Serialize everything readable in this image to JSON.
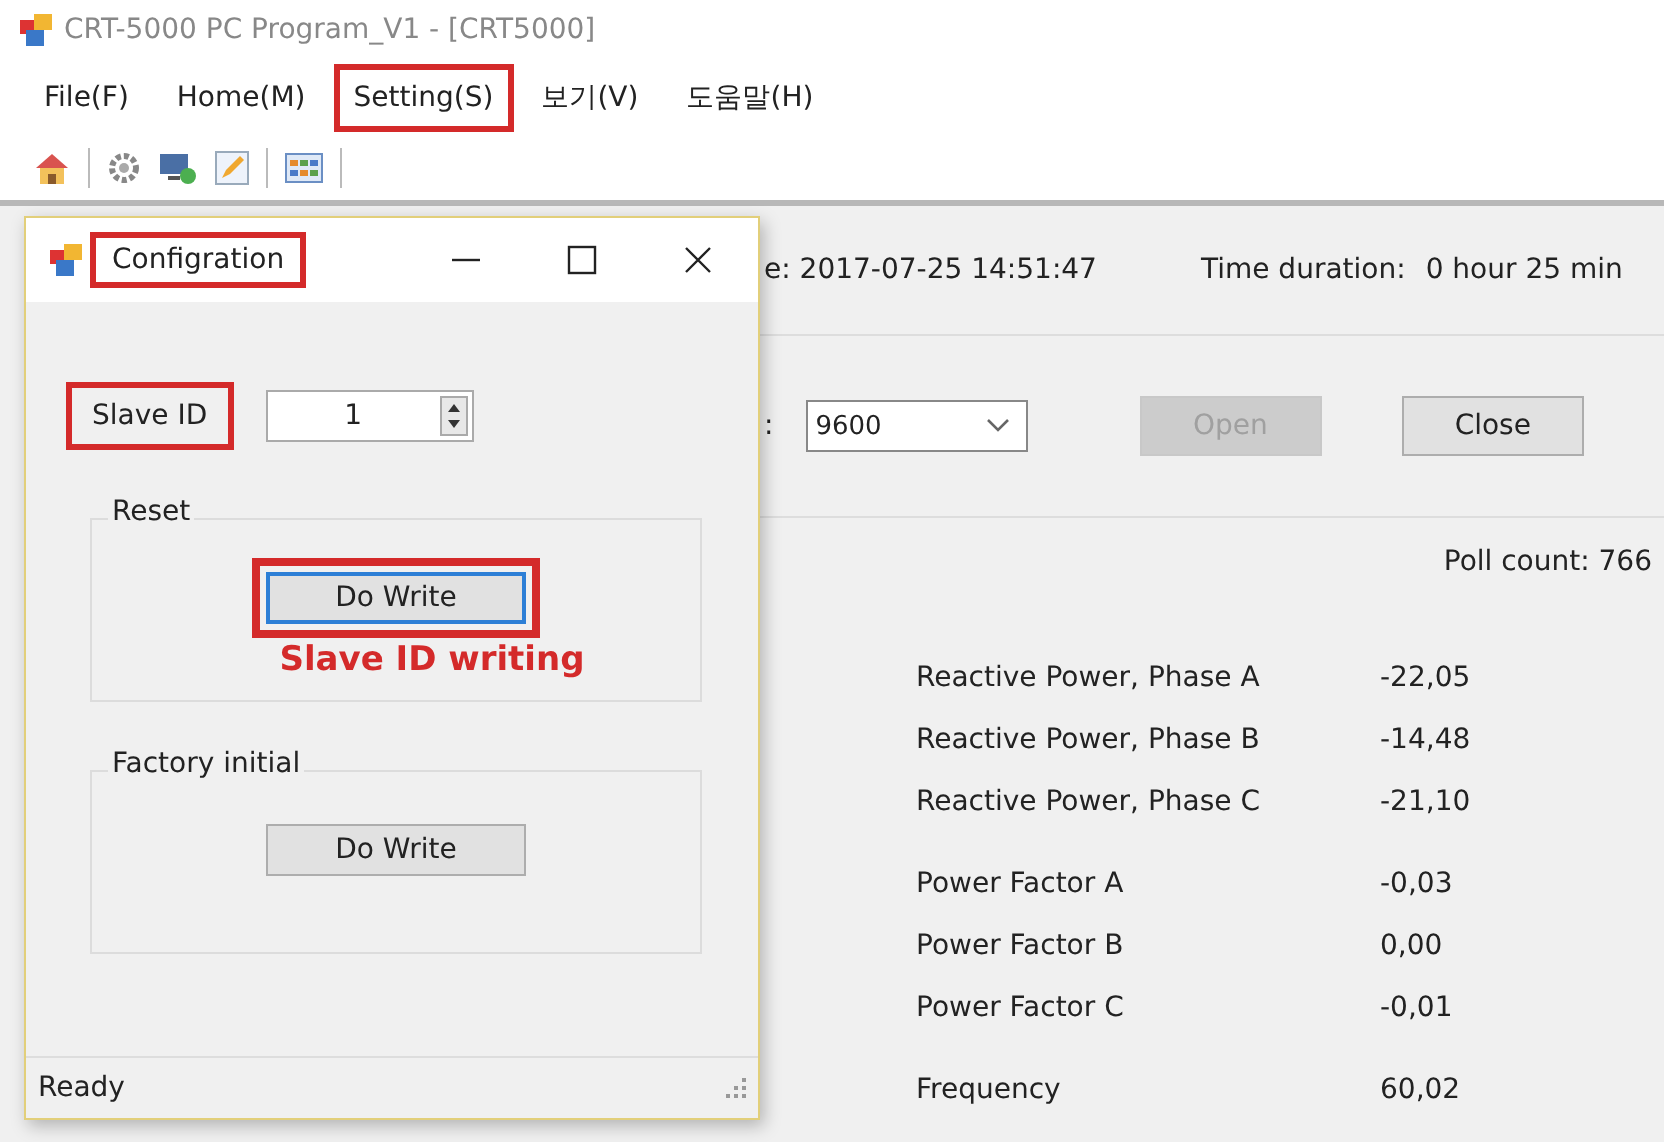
{
  "window": {
    "title": "CRT-5000 PC Program_V1 - [CRT5000]"
  },
  "menu": [
    {
      "label": "File(F)",
      "highlighted": false
    },
    {
      "label": "Home(M)",
      "highlighted": false
    },
    {
      "label": "Setting(S)",
      "highlighted": true
    },
    {
      "label": "보기(V)",
      "highlighted": false
    },
    {
      "label": "도움말(H)",
      "highlighted": false
    }
  ],
  "main": {
    "start_time": "e: 2017-07-25 14:51:47",
    "duration_label": "Time duration:",
    "duration_value": "0 hour 25 min",
    "baud_label": ":",
    "baud_value": "9600",
    "buttons": [
      {
        "label": "Open",
        "disabled": true
      },
      {
        "label": "Close",
        "disabled": false
      }
    ],
    "poll_count": "Poll count: 766",
    "measurement_groups": [
      [
        {
          "name": "Reactive Power, Phase A",
          "value": "-22,05"
        },
        {
          "name": "Reactive Power, Phase B",
          "value": "-14,48"
        },
        {
          "name": "Reactive Power, Phase C",
          "value": "-21,10"
        }
      ],
      [
        {
          "name": "Power Factor A",
          "value": "-0,03"
        },
        {
          "name": "Power Factor B",
          "value": "0,00"
        },
        {
          "name": "Power Factor C",
          "value": "-0,01"
        }
      ],
      [
        {
          "name": "Frequency",
          "value": "60,02"
        }
      ]
    ]
  },
  "dialog": {
    "title": "Configration",
    "title_highlighted": true,
    "slave_id_label": "Slave ID",
    "slave_id_highlighted": true,
    "slave_id_value": "1",
    "groups": [
      {
        "label": "Reset",
        "button": "Do Write",
        "focused": true,
        "highlighted": true,
        "annotation": "Slave ID writing"
      },
      {
        "label": "Factory initial",
        "button": "Do Write",
        "focused": false,
        "highlighted": false
      }
    ],
    "status": "Ready"
  }
}
